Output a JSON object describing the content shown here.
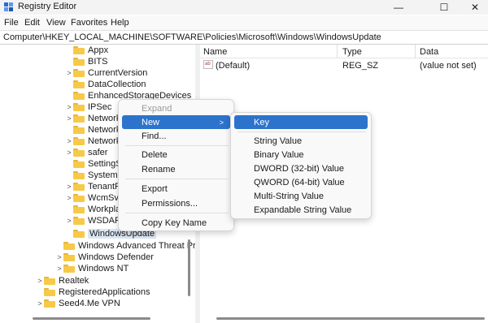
{
  "window": {
    "title": "Registry Editor",
    "minimize_glyph": "—",
    "maximize_glyph": "☐",
    "close_glyph": "✕"
  },
  "menubar": [
    "File",
    "Edit",
    "View",
    "Favorites",
    "Help"
  ],
  "address": "Computer\\HKEY_LOCAL_MACHINE\\SOFTWARE\\Policies\\Microsoft\\Windows\\WindowsUpdate",
  "tree": [
    {
      "label": "Appx",
      "chevron": ""
    },
    {
      "label": "BITS",
      "chevron": ""
    },
    {
      "label": "CurrentVersion",
      "chevron": ">"
    },
    {
      "label": "DataCollection",
      "chevron": ""
    },
    {
      "label": "EnhancedStorageDevices",
      "chevron": ""
    },
    {
      "label": "IPSec",
      "chevron": ">"
    },
    {
      "label": "Network",
      "chevron": ">"
    },
    {
      "label": "Network",
      "chevron": ""
    },
    {
      "label": "Network",
      "chevron": ">"
    },
    {
      "label": "safer",
      "chevron": ">"
    },
    {
      "label": "SettingSy",
      "chevron": ""
    },
    {
      "label": "System",
      "chevron": ""
    },
    {
      "label": "TenantRe",
      "chevron": ">"
    },
    {
      "label": "WcmSvc",
      "chevron": ">"
    },
    {
      "label": "Workpla",
      "chevron": ""
    },
    {
      "label": "WSDAPI",
      "chevron": ">"
    },
    {
      "label": "WindowsUpdate",
      "chevron": ""
    },
    {
      "label": "Windows Advanced Threat Prot",
      "chevron": ""
    },
    {
      "label": "Windows Defender",
      "chevron": ">"
    },
    {
      "label": "Windows NT",
      "chevron": ">"
    },
    {
      "label": "Realtek",
      "chevron": ">"
    },
    {
      "label": "RegisteredApplications",
      "chevron": ""
    },
    {
      "label": "Seed4.Me VPN",
      "chevron": ">"
    }
  ],
  "list": {
    "headers": {
      "name": "Name",
      "type": "Type",
      "data": "Data"
    },
    "icon_text": "ab",
    "rows": [
      {
        "name": "(Default)",
        "type": "REG_SZ",
        "data": "(value not set)"
      }
    ]
  },
  "context_menu": {
    "expand": "Expand",
    "new": "New",
    "find": "Find...",
    "delete": "Delete",
    "rename": "Rename",
    "export": "Export",
    "permissions": "Permissions...",
    "copy_key_name": "Copy Key Name",
    "arrow": ">"
  },
  "submenu": {
    "key": "Key",
    "string_value": "String Value",
    "binary_value": "Binary Value",
    "dword_value": "DWORD (32-bit) Value",
    "qword_value": "QWORD (64-bit) Value",
    "multi_string_value": "Multi-String Value",
    "expandable_string_value": "Expandable String Value"
  },
  "colors": {
    "highlight": "#2c73cc",
    "folder": "#f7c948",
    "selected_tree": "#dbe6f4"
  }
}
